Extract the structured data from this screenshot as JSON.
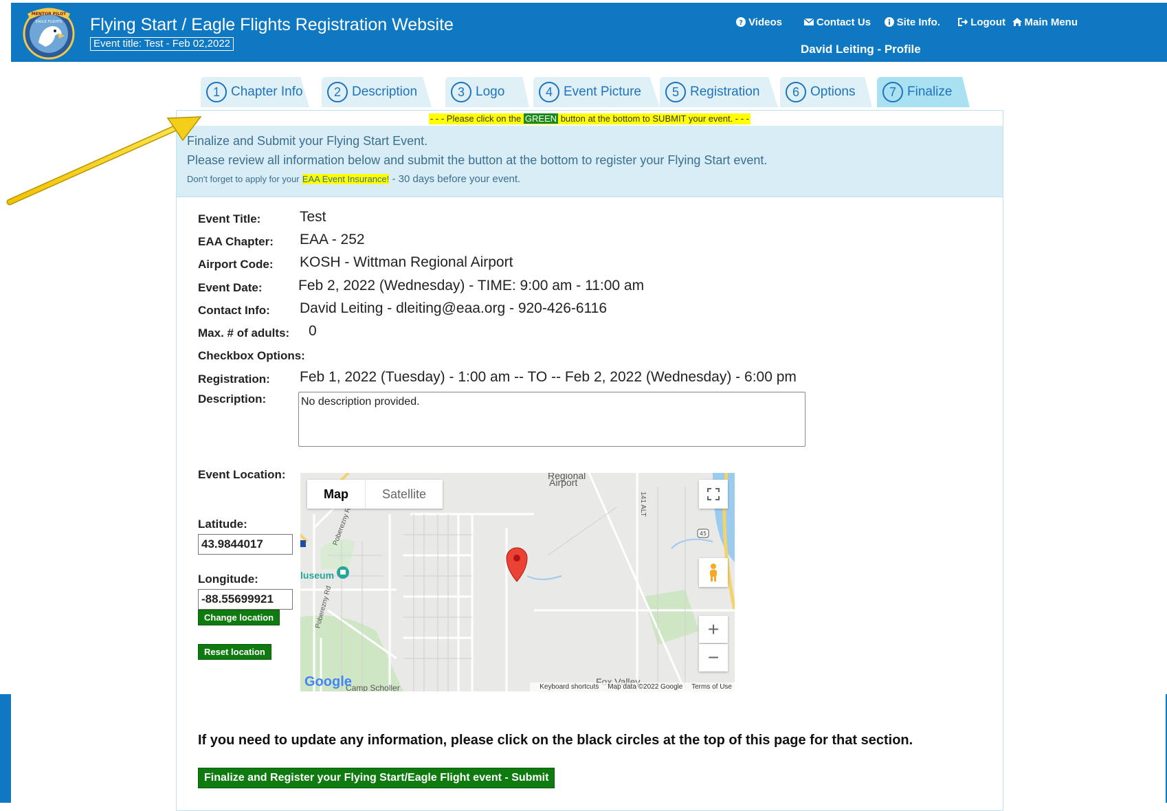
{
  "header": {
    "site_title": "Flying Start / Eagle Flights Registration Website",
    "event_title": "Event title: Test - Feb 02,2022",
    "profile": "David Leiting - Profile",
    "logo_text_top": "MENTOR PILOT",
    "logo_text_mid": "EAGLE FLIGHTS",
    "nav": [
      {
        "label": "Videos",
        "icon": "question-circle-icon"
      },
      {
        "label": "Contact Us",
        "icon": "envelope-icon"
      },
      {
        "label": "Site Info.",
        "icon": "info-circle-icon"
      },
      {
        "label": "Logout",
        "icon": "logout-icon"
      },
      {
        "label": "Main Menu",
        "icon": "home-icon"
      }
    ]
  },
  "tabs": [
    {
      "num": "1",
      "label": "Chapter Info"
    },
    {
      "num": "2",
      "label": "Description"
    },
    {
      "num": "3",
      "label": "Logo"
    },
    {
      "num": "4",
      "label": "Event Picture"
    },
    {
      "num": "5",
      "label": "Registration"
    },
    {
      "num": "6",
      "label": "Options"
    },
    {
      "num": "7",
      "label": "Finalize",
      "active": true
    }
  ],
  "notice": {
    "prefix": "- - - Please click on the",
    "green": "GREEN",
    "suffix": "button at the bottom to SUBMIT your event. - - -"
  },
  "info": {
    "line1": "Finalize and Submit your Flying Start Event.",
    "line2": "Please review all information below and submit the button at the bottom to register your Flying Start event.",
    "line3_prefix": "Don't forget to apply for your",
    "line3_highlight": "EAA Event Insurance!",
    "line3_suffix": "- 30 days before your event."
  },
  "details": {
    "event_title_label": "Event Title:",
    "event_title": "Test",
    "chapter_label": "EAA Chapter:",
    "chapter": "EAA - 252",
    "airport_label": "Airport Code:",
    "airport": "KOSH - Wittman Regional Airport",
    "date_label": "Event Date:",
    "date": "Feb 2, 2022 (Wednesday) - TIME: 9:00 am - 11:00 am",
    "contact_label": "Contact Info:",
    "contact": "David Leiting - dleiting@eaa.org - 920-426-6116",
    "max_adults_label": "Max. # of adults:",
    "max_adults": "0",
    "checkbox_label": "Checkbox Options:",
    "registration_label": "Registration:",
    "registration": "Feb 1, 2022 (Tuesday) - 1:00 am -- TO -- Feb 2, 2022 (Wednesday) - 6:00 pm",
    "description_label": "Description:",
    "description": "No description provided."
  },
  "location": {
    "label": "Event Location:",
    "latitude_label": "Latitude:",
    "latitude": "43.9844017",
    "longitude_label": "Longitude:",
    "longitude": "-88.55699921",
    "change_button": "Change location",
    "reset_button": "Reset location"
  },
  "map": {
    "tab_map": "Map",
    "tab_satellite": "Satellite",
    "label_airport_top": "Regional",
    "label_airport": "Airport",
    "label_museum": "luseum",
    "label_road1": "Poberezny Rd",
    "label_road2": "Poberezny Rd",
    "label_hwy": "141 ALT",
    "label_shield": "45",
    "label_foxvalley": "Fox Valley",
    "label_bottom": "Camp Scholler",
    "google": "Google",
    "footer_shortcuts": "Keyboard shortcuts",
    "footer_data": "Map data ©2022 Google",
    "footer_terms": "Terms of Use",
    "zoom_in": "+",
    "zoom_out": "−"
  },
  "update_note": "If you need to update any information, please click on the black circles at the top of this page for that section.",
  "submit_button": "Finalize and Register your Flying Start/Eagle Flight event - Submit",
  "colors": {
    "header_blue": "#0f78c2",
    "submit_green": "#0f7a0f",
    "highlight_yellow": "#ffff00",
    "info_bg": "#d9edf7"
  }
}
